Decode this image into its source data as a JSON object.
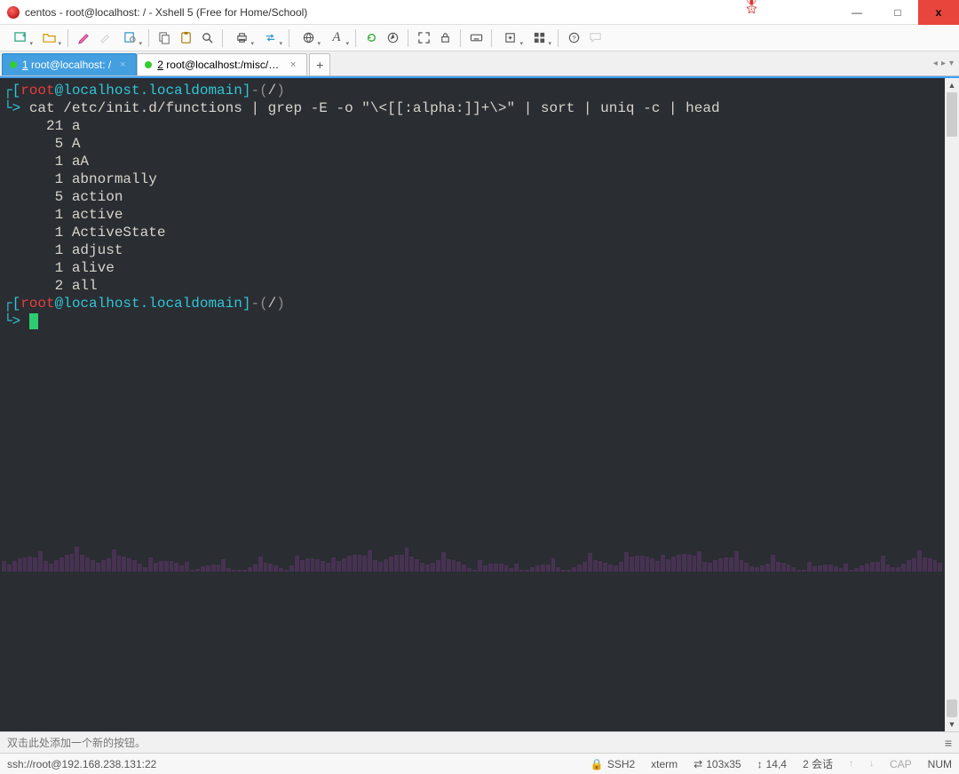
{
  "window": {
    "title": "centos - root@localhost: / - Xshell 5 (Free for Home/School)"
  },
  "toolbar_icons": [
    "new-session",
    "open",
    "sep",
    "highlighter",
    "color-picker",
    "settings",
    "sep",
    "copy",
    "paste",
    "find",
    "sep",
    "print",
    "transfer",
    "sep",
    "globe",
    "font",
    "sep",
    "reload",
    "compass",
    "sep",
    "fullscreen",
    "lock",
    "sep",
    "keyboard",
    "sep",
    "new-window",
    "layout",
    "sep",
    "help",
    "feedback"
  ],
  "tabs": [
    {
      "num": "1",
      "label": "root@localhost: /",
      "active": true
    },
    {
      "num": "2",
      "label": "root@localhost:/misc/cd/Pa...",
      "active": false
    }
  ],
  "terminal": {
    "prompt1": {
      "user": "root",
      "at": "@",
      "host": "localhost.localdomain",
      "path": "/"
    },
    "command": "cat /etc/init.d/functions | grep -E -o \"\\<[[:alpha:]]+\\>\" | sort | uniq -c | head",
    "output": [
      {
        "count": "21",
        "word": "a"
      },
      {
        "count": "5",
        "word": "A"
      },
      {
        "count": "1",
        "word": "aA"
      },
      {
        "count": "1",
        "word": "abnormally"
      },
      {
        "count": "5",
        "word": "action"
      },
      {
        "count": "1",
        "word": "active"
      },
      {
        "count": "1",
        "word": "ActiveState"
      },
      {
        "count": "1",
        "word": "adjust"
      },
      {
        "count": "1",
        "word": "alive"
      },
      {
        "count": "2",
        "word": "all"
      }
    ],
    "prompt2": {
      "user": "root",
      "at": "@",
      "host": "localhost.localdomain",
      "path": "/"
    }
  },
  "hint": "双击此处添加一个新的按钮。",
  "status": {
    "conn": "ssh://root@192.168.238.131:22",
    "proto_icon": "🔒",
    "proto": "SSH2",
    "term": "xterm",
    "size_icon": "⇄",
    "size": "103x35",
    "cursor_icon": "↕",
    "cursor": "14,4",
    "sessions": "2 会话",
    "cap": "CAP",
    "num": "NUM"
  },
  "glyphs": {
    "minimize": "—",
    "maximize": "□",
    "close": "x",
    "plus": "+",
    "tri_left": "◂",
    "tri_right": "▸",
    "dropdown": "▾",
    "hamburger": "≡",
    "arrow_up": "↑",
    "arrow_down": "↓"
  }
}
